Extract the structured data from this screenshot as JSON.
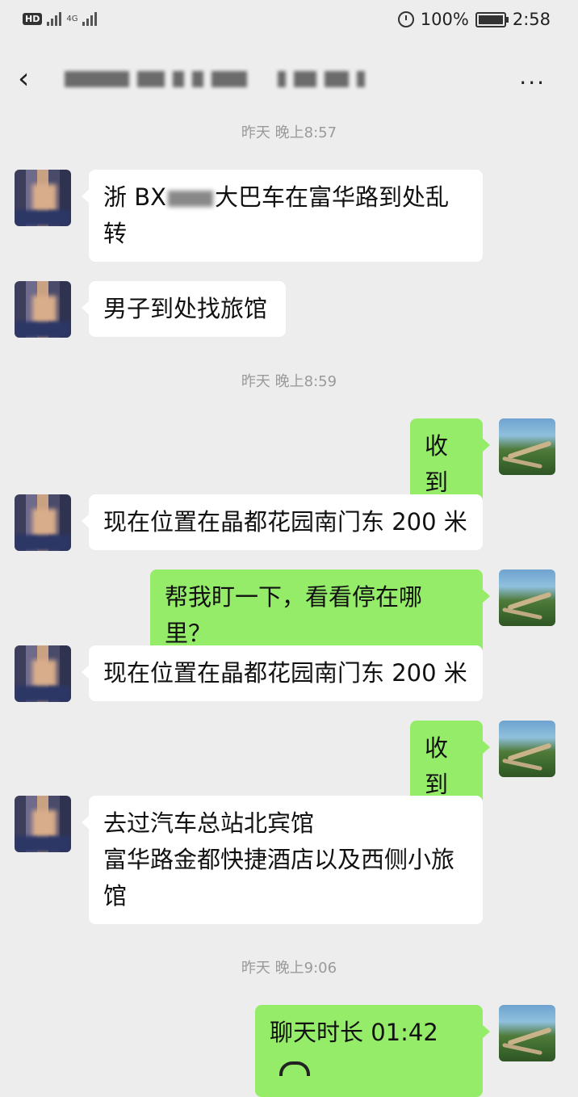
{
  "status_bar": {
    "hd_label": "HD",
    "network_label": "4G",
    "battery": "100%",
    "time": "2:58"
  },
  "header": {
    "title": "",
    "more_label": "···"
  },
  "chat": {
    "time_1": "昨天 晚上8:57",
    "msg_1_prefix": "浙 BX",
    "msg_1_suffix": "大巴车在富华路到处乱转",
    "msg_2": "男子到处找旅馆",
    "time_2": "昨天 晚上8:59",
    "msg_3": "收到",
    "msg_4": "现在位置在晶都花园南门东 200 米",
    "msg_5": "帮我盯一下，看看停在哪里？",
    "msg_6": "现在位置在晶都花园南门东 200 米",
    "msg_7": "收到",
    "msg_8_line1": "去过汽车总站北宾馆",
    "msg_8_line2": "富华路金都快捷酒店以及西侧小旅馆",
    "time_3": "昨天 晚上9:06",
    "msg_9": "聊天时长 01:42"
  },
  "icons": {
    "back": "chevron-left-icon",
    "more": "more-horizontal-icon",
    "call": "phone-hangup-icon",
    "alarm": "alarm-icon",
    "battery": "battery-icon"
  },
  "colors": {
    "background": "#ededed",
    "incoming_bubble": "#ffffff",
    "outgoing_bubble": "#95ec69"
  }
}
